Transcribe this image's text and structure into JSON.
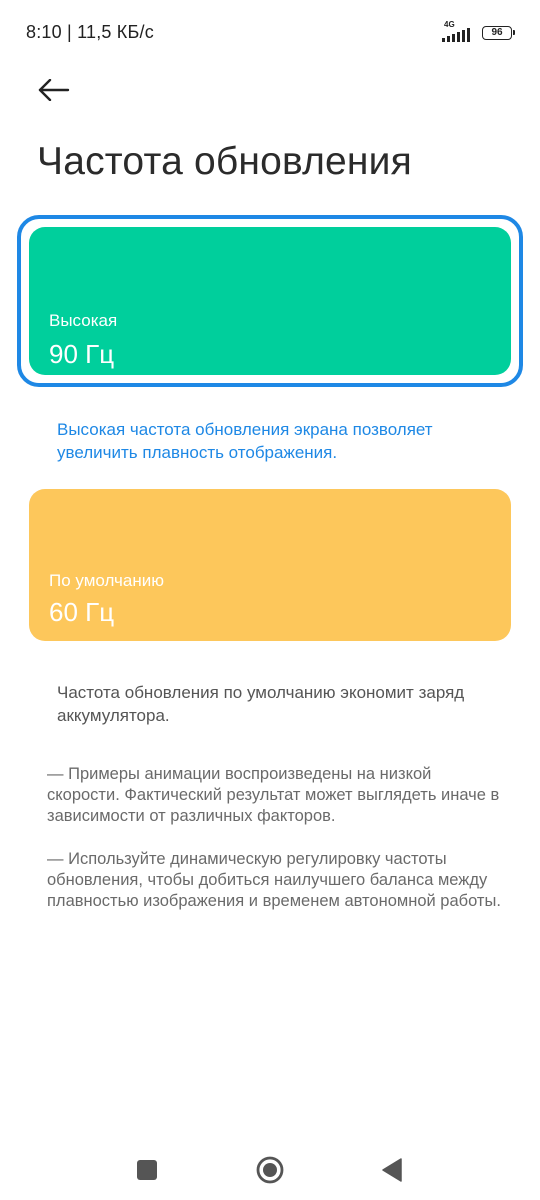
{
  "status_bar": {
    "time_and_speed": "8:10 | 11,5 КБ/с",
    "network_type": "4G",
    "battery_level": "96"
  },
  "header": {
    "back_icon": "arrow-left-icon",
    "title": "Частота обновления"
  },
  "options": [
    {
      "label": "Высокая",
      "value": "90 Гц",
      "color": "#00cf9c",
      "selected": true,
      "description": "Высокая частота обновления экрана позволяет увеличить плавность отображения."
    },
    {
      "label": "По умолчанию",
      "value": "60 Гц",
      "color": "#fdc75b",
      "selected": false,
      "description": "Частота обновления по умолчанию экономит заряд аккумулятора."
    }
  ],
  "notes": [
    "— Примеры анимации воспроизведены на низкой скорости. Фактический результат может выглядеть иначе в зависимости от различных факторов.",
    "— Используйте динамическую регулировку частоты обновления, чтобы добиться наилучшего баланса между плавностью изображения и временем автономной работы."
  ],
  "colors": {
    "accent": "#1e88e5",
    "high_card": "#00cf9c",
    "default_card": "#fdc75b"
  },
  "nav_bar": {
    "recents_icon": "square-icon",
    "home_icon": "circle-icon",
    "back_icon": "triangle-back-icon"
  }
}
